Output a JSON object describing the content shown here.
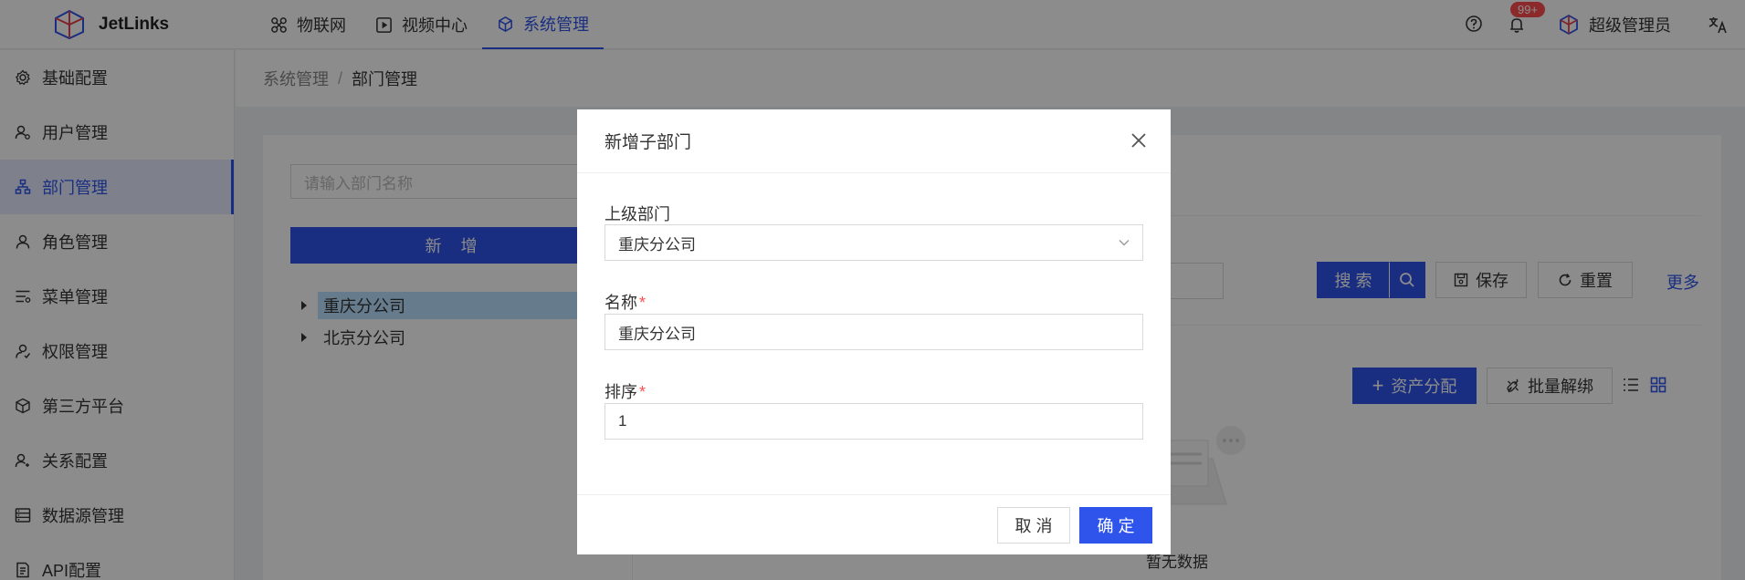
{
  "header": {
    "brand": "JetLinks",
    "nav": [
      {
        "label": "物联网",
        "icon": "cluster-icon"
      },
      {
        "label": "视频中心",
        "icon": "play-square-icon"
      },
      {
        "label": "系统管理",
        "icon": "cube-icon"
      }
    ],
    "notification_badge": "99+",
    "user_name": "超级管理员"
  },
  "sidebar": {
    "items": [
      {
        "label": "基础配置",
        "icon": "gear-icon"
      },
      {
        "label": "用户管理",
        "icon": "user-manage-icon"
      },
      {
        "label": "部门管理",
        "icon": "org-tree-icon"
      },
      {
        "label": "角色管理",
        "icon": "role-icon"
      },
      {
        "label": "菜单管理",
        "icon": "menu-list-icon"
      },
      {
        "label": "权限管理",
        "icon": "permission-icon"
      },
      {
        "label": "第三方平台",
        "icon": "platform-icon"
      },
      {
        "label": "关系配置",
        "icon": "relation-icon"
      },
      {
        "label": "数据源管理",
        "icon": "database-icon"
      },
      {
        "label": "API配置",
        "icon": "api-doc-icon"
      }
    ],
    "active_label": "部门管理"
  },
  "breadcrumb": {
    "parent": "系统管理",
    "separator": "/",
    "current": "部门管理"
  },
  "dept_panel": {
    "search_placeholder": "请输入部门名称",
    "add_label": "新 增",
    "tree": [
      "重庆分公司",
      "北京分公司"
    ]
  },
  "toolbar": {
    "search_label": "搜 索",
    "save_label": "保存",
    "reset_label": "重置",
    "more_label": "更多",
    "assign_label": "资产分配",
    "unbind_label": "批量解绑",
    "empty_text": "暂无数据"
  },
  "modal": {
    "title": "新增子部门",
    "parent_label": "上级部门",
    "parent_value": "重庆分公司",
    "name_label": "名称",
    "name_value": "重庆分公司",
    "order_label": "排序",
    "order_value": "1",
    "required_mark": "*",
    "cancel_label": "取 消",
    "ok_label": "确 定"
  },
  "colors": {
    "primary": "#2f54eb",
    "danger": "#ff4d4f",
    "mask": "rgba(0,0,0,0.45)"
  }
}
